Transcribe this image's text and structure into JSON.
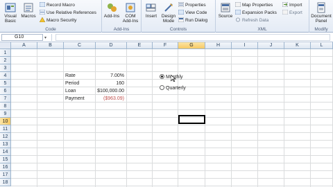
{
  "ribbon": {
    "code": {
      "label": "Code",
      "visual_basic": [
        "Visual",
        "Basic"
      ],
      "macros": "Macros",
      "record_macro": "Record Macro",
      "use_relative": "Use Relative References",
      "macro_security": "Macro Security"
    },
    "addins": {
      "label": "Add-Ins",
      "addins": "Add-Ins",
      "com_addins": [
        "COM",
        "Add-Ins"
      ]
    },
    "controls": {
      "label": "Controls",
      "insert": "Insert",
      "design_mode": [
        "Design",
        "Mode"
      ],
      "properties": "Properties",
      "view_code": "View Code",
      "run_dialog": "Run Dialog"
    },
    "xml": {
      "label": "XML",
      "source": "Source",
      "map_properties": "Map Properties",
      "expansion_packs": "Expansion Packs",
      "refresh_data": "Refresh Data",
      "import": "Import",
      "export": "Export"
    },
    "modify": {
      "label": "Modify",
      "document_panel": [
        "Document",
        "Panel"
      ]
    }
  },
  "formula_bar": {
    "name_box": "G10",
    "content": ""
  },
  "columns": [
    "A",
    "B",
    "C",
    "D",
    "E",
    "F",
    "G",
    "H",
    "I",
    "J",
    "K",
    "L"
  ],
  "rows": [
    "1",
    "2",
    "3",
    "4",
    "5",
    "6",
    "7",
    "8",
    "9",
    "10",
    "11",
    "12",
    "13",
    "14",
    "15",
    "16",
    "17",
    "18"
  ],
  "active_column": "G",
  "active_row": "10",
  "cells": [
    {
      "label": "Rate",
      "value": "7.00%",
      "negative": false
    },
    {
      "label": "Period",
      "value": "160",
      "negative": false
    },
    {
      "label": "Loan",
      "value": "$100,000.00",
      "negative": false
    },
    {
      "label": "Payment",
      "value": "($963.09)",
      "negative": true
    }
  ],
  "options": [
    {
      "label": "Monthly",
      "checked": true
    },
    {
      "label": "Quarterly",
      "checked": false
    }
  ],
  "colors": {
    "accent": "#f7c964",
    "negative": "#c0504d",
    "gridline": "#dadcdd"
  }
}
